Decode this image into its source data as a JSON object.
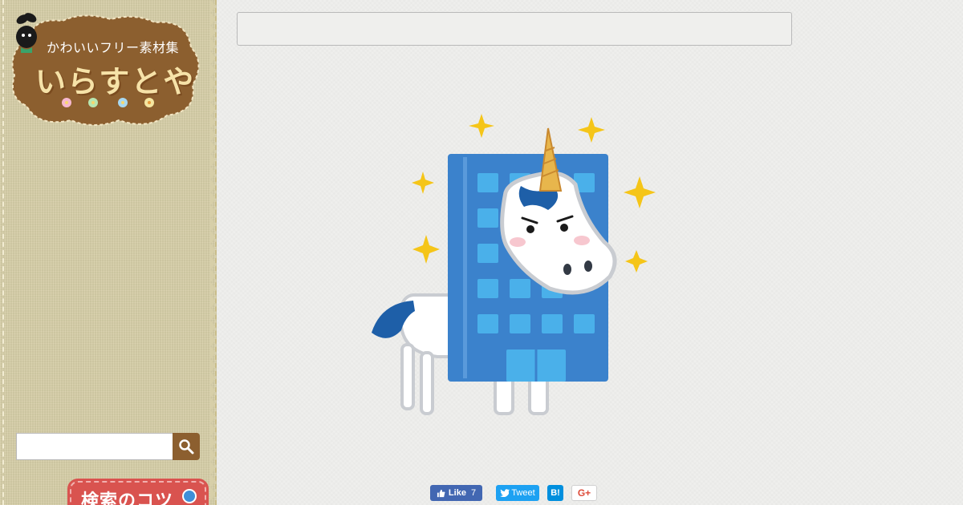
{
  "logo": {
    "subtitle": "かわいいフリー素材集",
    "title": "いらすとや"
  },
  "search": {
    "value": "",
    "placeholder": "",
    "button_icon": "search-icon"
  },
  "search_tips": {
    "label": "検索のコツ"
  },
  "illustration": {
    "subject": "unicorn-company-icon"
  },
  "share": {
    "facebook_label": "Like",
    "facebook_count": "7",
    "twitter_label": "Tweet",
    "hatena_label": "B!",
    "gplus_label": "G+"
  },
  "colors": {
    "sidebar_bg": "#d7cfa8",
    "logo_brown": "#8c5f2f",
    "building_blue": "#3b82cc",
    "window_blue": "#4ab0ea",
    "horn_gold": "#e8b64c",
    "sparkle_yellow": "#f5c518",
    "tips_red": "#d9534f"
  }
}
